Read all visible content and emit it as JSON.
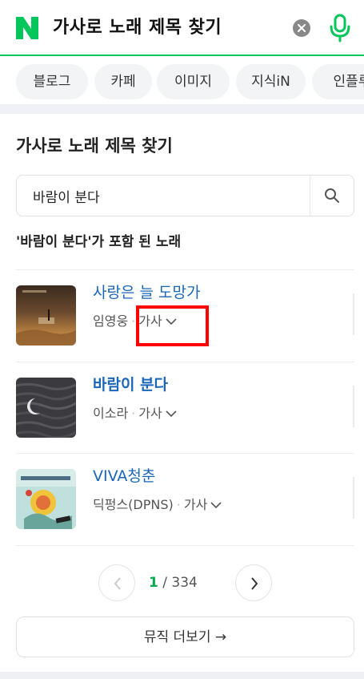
{
  "header": {
    "query": "가사로 노래 제목 찾기"
  },
  "tabs": [
    {
      "label": "블로그"
    },
    {
      "label": "카페"
    },
    {
      "label": "이미지"
    },
    {
      "label": "지식iN"
    },
    {
      "label": "인플루"
    }
  ],
  "section": {
    "title": "가사로 노래 제목 찾기",
    "search_value": "바람이 분다",
    "result_caption": "'바람이 분다'가 포함 된 노래"
  },
  "songs": [
    {
      "title": "사랑은 늘 도망가",
      "artist": "임영웅",
      "lyrics_label": "가사",
      "title_bold": false
    },
    {
      "title": "바람이 분다",
      "artist": "이소라",
      "lyrics_label": "가사",
      "title_bold": true
    },
    {
      "title": "VIVA청춘",
      "artist": "딕펑스(DPNS)",
      "lyrics_label": "가사",
      "title_bold": false
    }
  ],
  "pagination": {
    "current": "1",
    "separator": "/",
    "total": "334"
  },
  "more_button": {
    "label": "뮤직 더보기 →"
  },
  "colors": {
    "brand": "#03c75a",
    "link": "#1a66b8",
    "highlight": "#ff0000"
  }
}
